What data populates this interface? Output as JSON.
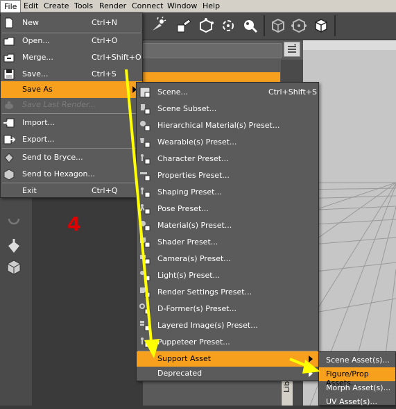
{
  "menubar": {
    "items": [
      "File",
      "Edit",
      "Create",
      "Tools",
      "Render",
      "Connect",
      "Window",
      "Help"
    ]
  },
  "toolbar": {
    "icons": [
      "spotlight-tool-icon",
      "paint-tool-icon",
      "joint-tool-icon",
      "rotate-tool-icon",
      "surface-selection-icon",
      "cube-tool-icon",
      "node-tool-icon",
      "box-tool-icon"
    ]
  },
  "file_menu": {
    "items": [
      {
        "label": "New",
        "shortcut": "Ctrl+N",
        "icon": "new-file-icon"
      },
      {
        "label": "Open...",
        "shortcut": "Ctrl+O",
        "icon": "open-folder-icon"
      },
      {
        "label": "Merge...",
        "shortcut": "Ctrl+Shift+O",
        "icon": "merge-folder-icon"
      },
      {
        "label": "Save...",
        "shortcut": "Ctrl+S",
        "icon": "save-disk-icon"
      },
      {
        "label": "Save As",
        "shortcut": "",
        "icon": ""
      },
      {
        "label": "Save Last Render...",
        "shortcut": "",
        "icon": "render-teapot-icon"
      },
      {
        "label": "Import...",
        "shortcut": "",
        "icon": "import-icon"
      },
      {
        "label": "Export...",
        "shortcut": "",
        "icon": "export-icon"
      },
      {
        "label": "Send to Bryce...",
        "shortcut": "",
        "icon": "bryce-icon"
      },
      {
        "label": "Send to Hexagon...",
        "shortcut": "",
        "icon": "hexagon-icon"
      },
      {
        "label": "Exit",
        "shortcut": "Ctrl+Q",
        "icon": ""
      }
    ]
  },
  "saveas_menu": {
    "items": [
      {
        "label": "Scene...",
        "shortcut": "Ctrl+Shift+S"
      },
      {
        "label": "Scene Subset..."
      },
      {
        "label": "Hierarchical Material(s) Preset..."
      },
      {
        "label": "Wearable(s) Preset..."
      },
      {
        "label": "Character Preset..."
      },
      {
        "label": "Properties Preset..."
      },
      {
        "label": "Shaping Preset..."
      },
      {
        "label": "Pose Preset..."
      },
      {
        "label": "Material(s) Preset..."
      },
      {
        "label": "Shader Preset..."
      },
      {
        "label": "Camera(s) Preset..."
      },
      {
        "label": "Light(s) Preset..."
      },
      {
        "label": "Render Settings Preset..."
      },
      {
        "label": "D-Former(s) Preset..."
      },
      {
        "label": "Layered Image(s) Preset..."
      },
      {
        "label": "Puppeteer Preset..."
      },
      {
        "label": "Support Asset"
      },
      {
        "label": "Deprecated"
      }
    ]
  },
  "support_menu": {
    "items": [
      {
        "label": "Scene Asset(s)..."
      },
      {
        "label": "Figure/Prop Assets..."
      },
      {
        "label": "Morph Asset(s)..."
      },
      {
        "label": "UV Asset(s)..."
      }
    ]
  },
  "annotation": {
    "step_number": "4",
    "arrow_color": "#ffff00",
    "number_color": "#e00000"
  },
  "panel": {
    "side_tab": "Library"
  },
  "colors": {
    "highlight": "#f7a01e",
    "menu_bg": "#5b5b5b"
  }
}
